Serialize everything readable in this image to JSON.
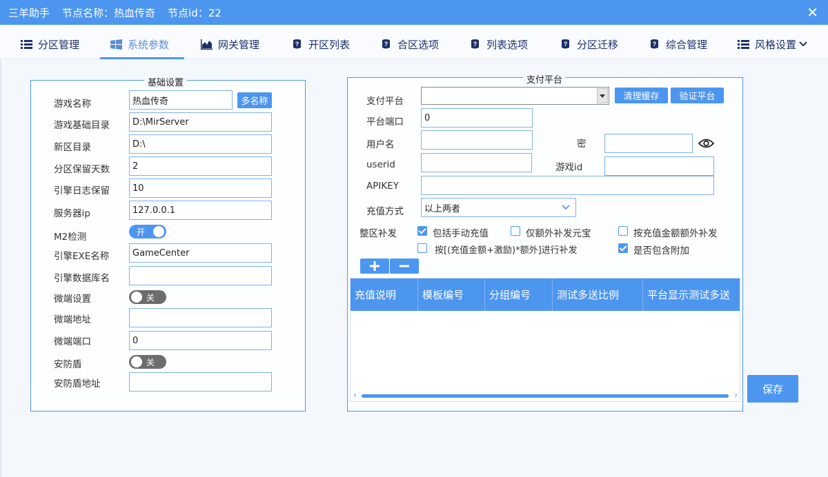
{
  "titlebar": {
    "app": "三羊助手",
    "node_name": "节点名称：热血传奇",
    "node_id": "节点id：22",
    "close": "✕"
  },
  "tabs": [
    {
      "label": "分区管理",
      "icon": "list-icon"
    },
    {
      "label": "系统参数",
      "icon": "windows-icon",
      "active": true
    },
    {
      "label": "网关管理",
      "icon": "chart-icon"
    },
    {
      "label": "开区列表",
      "icon": "badge-icon"
    },
    {
      "label": "合区选项",
      "icon": "badge-icon"
    },
    {
      "label": "列表选项",
      "icon": "badge-icon"
    },
    {
      "label": "分区迁移",
      "icon": "badge-icon"
    },
    {
      "label": "综合管理",
      "icon": "badge-icon"
    },
    {
      "label": "风格设置",
      "icon": "list-icon",
      "dropdown": "chevron-down-icon"
    }
  ],
  "basic": {
    "legend": "基础设置",
    "game_name_label": "游戏名称",
    "game_name_value": "热血传奇",
    "multi_name_btn": "多名称",
    "base_dir_label": "游戏基础目录",
    "base_dir_value": "D:\\MirServer",
    "new_dir_label": "新区目录",
    "new_dir_value": "D:\\",
    "keep_days_label": "分区保留天数",
    "keep_days_value": "2",
    "log_keep_label": "引擎日志保留",
    "log_keep_value": "10",
    "server_ip_label": "服务器ip",
    "server_ip_value": "127.0.0.1",
    "m2_label": "M2检测",
    "m2_toggle": "开",
    "exe_label": "引擎EXE名称",
    "exe_value": "GameCenter",
    "db_label": "引擎数据库名",
    "db_value": "",
    "micro_label": "微端设置",
    "micro_toggle": "关",
    "micro_addr_label": "微端地址",
    "micro_addr_value": "",
    "micro_port_label": "微端端口",
    "micro_port_value": "0",
    "shield_label": "安防盾",
    "shield_toggle": "关",
    "shield_addr_label": "安防盾地址",
    "shield_addr_value": ""
  },
  "pay": {
    "legend": "支付平台",
    "platform_label": "支付平台",
    "platform_value": "",
    "clear_cache_btn": "清理缓存",
    "verify_btn": "验证平台",
    "port_label": "平台端口",
    "port_value": "0",
    "user_label": "用户名",
    "user_value": "",
    "pwd_label": "密",
    "pwd_value": "",
    "userid_label": "userid",
    "userid_value": "",
    "gameid_label": "游戏id",
    "gameid_value": "",
    "apikey_label": "APIKEY",
    "apikey_value": "",
    "method_label": "充值方式",
    "method_value": "以上两者",
    "reissue_label": "整区补发",
    "cb1": "包括手动充值",
    "cb2": "仅额外补发元宝",
    "cb3": "按充值金额额外补发",
    "cb4": "按[(充值金额+激励)*额外]进行补发",
    "cb5": "是否包含附加",
    "grid_headers": [
      "充值说明",
      "模板编号",
      "分组编号",
      "测试多送比例",
      "平台显示测试多送"
    ],
    "save_btn": "保存"
  },
  "colors": {
    "accent": "#4d96f0",
    "title_bg": "#4d96f0",
    "text": "#333333"
  }
}
